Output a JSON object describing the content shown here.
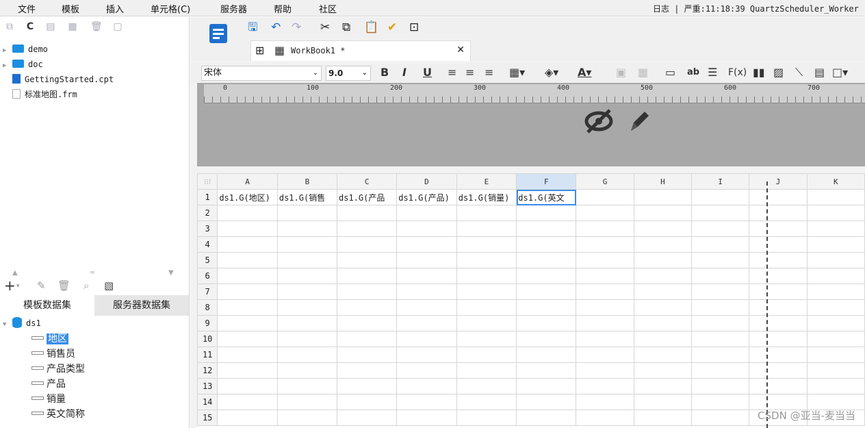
{
  "menu": [
    "文件",
    "模板",
    "插入",
    "单元格(C)",
    "服务器",
    "帮助",
    "社区"
  ],
  "status": "日志 | 严重:11:18:39 QuartzScheduler_Worker",
  "file_tree": [
    {
      "name": "demo",
      "type": "folder"
    },
    {
      "name": "doc",
      "type": "folder"
    },
    {
      "name": "GettingStarted.cpt",
      "type": "cpt"
    },
    {
      "name": "标准地图.frm",
      "type": "frm"
    }
  ],
  "dataset_tabs": {
    "template": "模板数据集",
    "server": "服务器数据集"
  },
  "dataset": {
    "name": "ds1",
    "fields": [
      "地区",
      "销售员",
      "产品类型",
      "产品",
      "销量",
      "英文简称"
    ],
    "selected": "地区"
  },
  "workbook_tab": "WorkBook1 *",
  "format": {
    "font": "宋体",
    "size": "9.0"
  },
  "ruler_ticks": [
    "0",
    "100",
    "200",
    "300",
    "400",
    "500",
    "600",
    "700"
  ],
  "columns": [
    "A",
    "B",
    "C",
    "D",
    "E",
    "F",
    "G",
    "H",
    "I",
    "J",
    "K"
  ],
  "rows": [
    "1",
    "2",
    "3",
    "4",
    "5",
    "6",
    "7",
    "8",
    "9",
    "10",
    "11",
    "12",
    "13",
    "14",
    "15"
  ],
  "row1_cells": [
    "ds1.G(地区)",
    "ds1.G(销售",
    "ds1.G(产品",
    "ds1.G(产品)",
    "ds1.G(销量)",
    "ds1.G(英文"
  ],
  "selected_column": "F",
  "watermark": "CSDN @亚当-麦当当"
}
